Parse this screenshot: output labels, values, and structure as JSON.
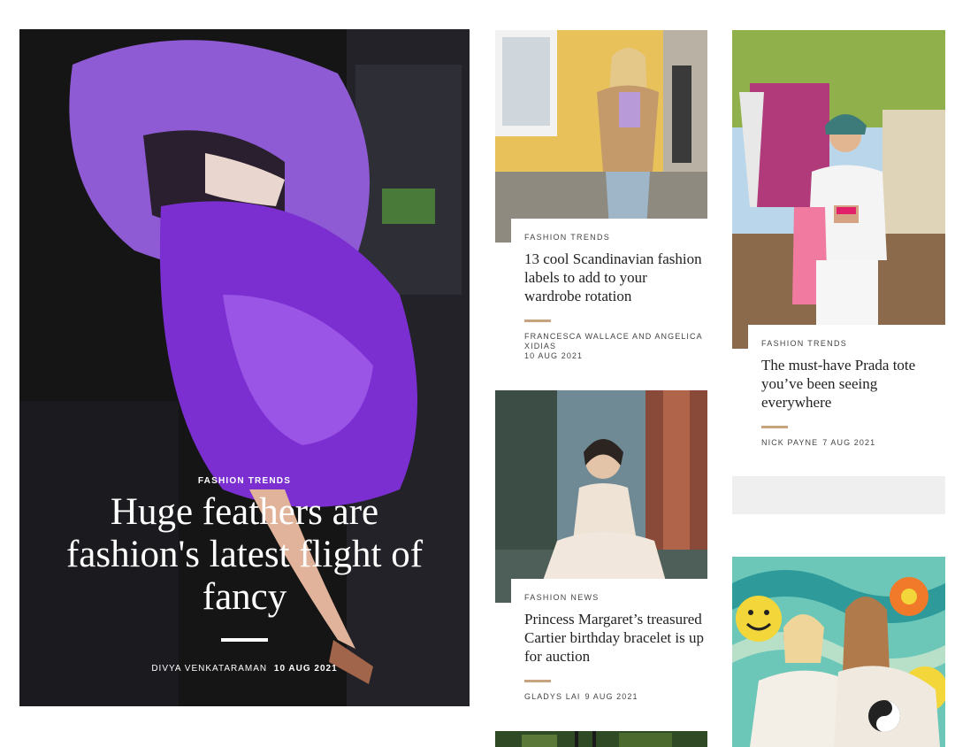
{
  "hero": {
    "category": "FASHION TRENDS",
    "title": "Huge feathers are fashion's latest flight of fancy",
    "author": "DIVYA VENKATARAMAN",
    "date": "10 AUG 2021"
  },
  "cards": [
    {
      "category": "FASHION TRENDS",
      "title": "13 cool Scandinavian fashion labels to add to your wardrobe rotation",
      "author": "FRANCESCA WALLACE AND ANGELICA XIDIAS",
      "date": "10 AUG 2021"
    },
    {
      "category": "FASHION NEWS",
      "title": "Princess Margaret’s treasured Cartier birthday bracelet is up for auction",
      "author": "GLADYS LAI",
      "date": "9 AUG 2021"
    },
    {
      "category": "FASHION TRENDS",
      "title": "The must-have Prada tote you’ve been seeing everywhere",
      "author": "NICK PAYNE",
      "date": "7 AUG 2021"
    }
  ],
  "colors": {
    "accent_rule": "#c8a37e",
    "placeholder": "#efefef"
  }
}
